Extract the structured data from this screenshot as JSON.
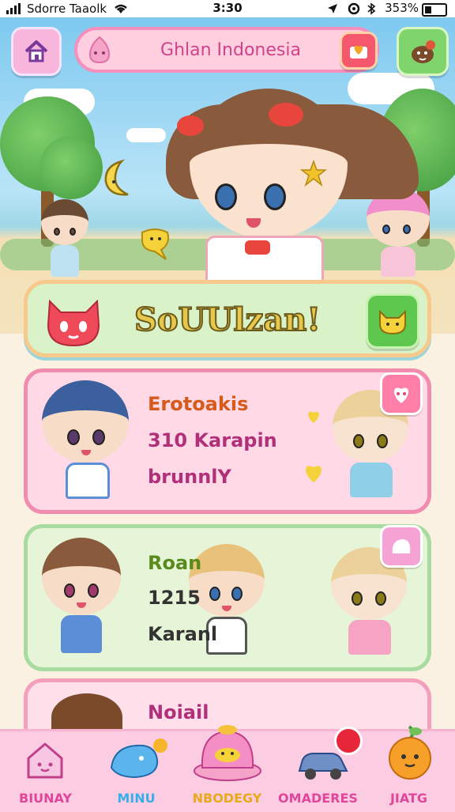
{
  "status_bar": {
    "carrier": "Sdorre Taaolk",
    "time": "3:30",
    "battery": "353%"
  },
  "header": {
    "home_icon": "home-icon",
    "title": "Ghlan Indonesia",
    "title_badge_icon": "heart-envelope-icon",
    "right_icon": "pet-face-icon"
  },
  "banner": {
    "text": "SoUUlzan!",
    "left_icon": "red-cat-icon",
    "right_icon": "yellow-cat-icon"
  },
  "cards": [
    {
      "lines": [
        "Erotoakis",
        "310 Karapin",
        "brunnlY"
      ],
      "badge_icon": "heart-face-icon"
    },
    {
      "lines": [
        "Roan",
        "1215",
        "Karanl"
      ],
      "badge_icon": "pastry-icon"
    },
    {
      "lines": [
        "Noiail"
      ]
    }
  ],
  "nav": [
    {
      "label": "BIUNAY",
      "icon": "house-face-icon",
      "color": "#e0469a"
    },
    {
      "label": "MINU",
      "icon": "blue-bird-icon",
      "color": "#38aee8"
    },
    {
      "label": "NBODEGY",
      "icon": "pink-pot-icon",
      "color": "#e8a91a"
    },
    {
      "label": "OMADERES",
      "icon": "blue-car-icon",
      "color": "#e0469a"
    },
    {
      "label": "JIATG",
      "icon": "orange-fruit-icon",
      "color": "#e0469a"
    }
  ]
}
